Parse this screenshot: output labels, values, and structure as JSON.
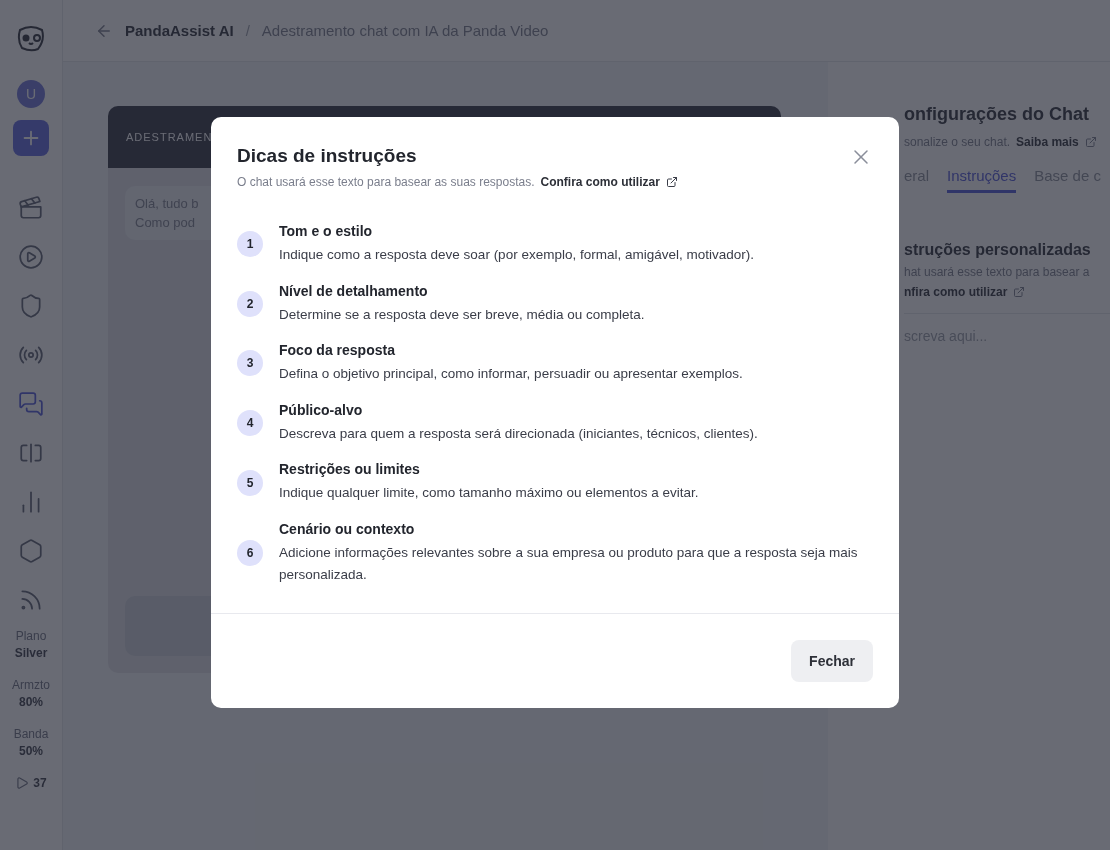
{
  "sidebar": {
    "avatar": "U",
    "items": [
      {
        "selected": false
      },
      {
        "selected": false
      },
      {
        "selected": false
      },
      {
        "selected": false
      },
      {
        "selected": true
      },
      {
        "selected": false
      },
      {
        "selected": false
      },
      {
        "selected": false
      },
      {
        "selected": false
      }
    ],
    "stats": [
      {
        "label": "Plano",
        "value": "Silver"
      },
      {
        "label": "Armzto",
        "value": "80%"
      },
      {
        "label": "Banda",
        "value": "50%"
      }
    ],
    "credits": "37"
  },
  "breadcrumb": {
    "root": "PandaAssist AI",
    "separator": "/",
    "current": "Adestramento chat com IA da Panda Video"
  },
  "chat_panel": {
    "title": "ADESTRAMEN",
    "message_lines": [
      "Olá, tudo b",
      "Como pod"
    ]
  },
  "settings_panel": {
    "title": "onfigurações do Chat",
    "subtitle": "sonalize o seu chat.",
    "subtitle_link": "Saiba mais",
    "tabs": [
      {
        "label": "eral",
        "selected": false
      },
      {
        "label": "Instruções",
        "selected": true
      },
      {
        "label": "Base de c",
        "selected": false
      }
    ],
    "section_title": "struções personalizadas",
    "section_text": "hat usará esse texto para basear a",
    "section_link": "nfira como utilizar",
    "placeholder": "screva aqui..."
  },
  "modal": {
    "title": "Dicas de instruções",
    "subtitle": "O chat usará esse texto para basear as suas respostas.",
    "subtitle_link": "Confira como utilizar",
    "tips": [
      {
        "number": "1",
        "title": "Tom e o estilo",
        "text": "Indique como a resposta deve soar (por exemplo, formal, amigável, motivador)."
      },
      {
        "number": "2",
        "title": "Nível de detalhamento",
        "text": "Determine se a resposta deve ser breve, média ou completa."
      },
      {
        "number": "3",
        "title": "Foco da resposta",
        "text": "Defina o objetivo principal, como informar, persuadir ou apresentar exemplos."
      },
      {
        "number": "4",
        "title": "Público-alvo",
        "text": "Descreva para quem a resposta será direcionada (iniciantes, técnicos, clientes)."
      },
      {
        "number": "5",
        "title": "Restrições ou limites",
        "text": "Indique qualquer limite, como tamanho máximo ou elementos a evitar."
      },
      {
        "number": "6",
        "title": "Cenário ou contexto",
        "text": "Adicione informações relevantes sobre a sua empresa ou produto para que a resposta seja mais personalizada."
      }
    ],
    "close_button": "Fechar"
  }
}
